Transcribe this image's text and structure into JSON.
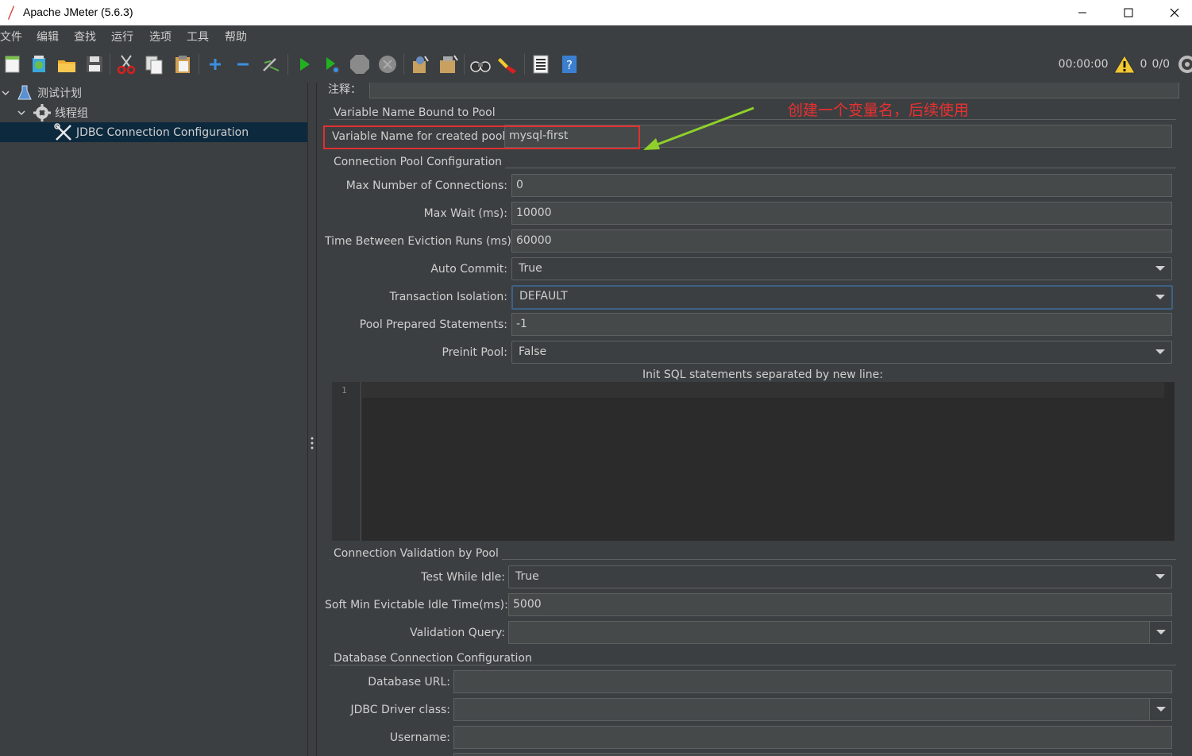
{
  "window": {
    "title": "Apache JMeter (5.6.3)"
  },
  "menu": [
    "文件",
    "编辑",
    "查找",
    "运行",
    "选项",
    "工具",
    "帮助"
  ],
  "toolbar": {
    "icons": [
      "new-icon",
      "templates-icon",
      "open-icon",
      "save-icon",
      "cut-icon",
      "copy-icon",
      "paste-icon",
      "expand-icon",
      "collapse-icon",
      "toggle-icon",
      "start-icon",
      "start-no-pause-icon",
      "stop-icon",
      "shutdown-icon",
      "clear-icon",
      "clear-all-icon",
      "search-icon",
      "reset-search-icon",
      "function-helper-icon",
      "help-icon"
    ],
    "timer": "00:00:00",
    "warning_count": "0",
    "threads": "0/0"
  },
  "tree": {
    "items": [
      {
        "label": "测试计划",
        "level": 0
      },
      {
        "label": "线程组",
        "level": 1
      },
      {
        "label": "JDBC Connection Configuration",
        "level": 2,
        "selected": true
      }
    ]
  },
  "form": {
    "comment_label": "注释：",
    "comment_value": "",
    "pool_section": "Variable Name Bound to Pool",
    "var_name_label": "Variable Name for created pool:",
    "var_name_value": "mysql-first",
    "annotation": "创建一个变量名，后续使用",
    "conn_pool_section": "Connection Pool Configuration",
    "max_conn_label": "Max Number of Connections:",
    "max_conn_value": "0",
    "max_wait_label": "Max Wait (ms):",
    "max_wait_value": "10000",
    "eviction_label": "Time Between Eviction Runs (ms):",
    "eviction_value": "60000",
    "auto_commit_label": "Auto Commit:",
    "auto_commit_value": "True",
    "isolation_label": "Transaction Isolation:",
    "isolation_value": "DEFAULT",
    "prepared_label": "Pool Prepared Statements:",
    "prepared_value": "-1",
    "preinit_label": "Preinit Pool:",
    "preinit_value": "False",
    "init_sql_label": "Init SQL statements separated by new line:",
    "init_sql_line": "1",
    "validation_section": "Connection Validation by Pool",
    "test_idle_label": "Test While Idle:",
    "test_idle_value": "True",
    "soft_min_label": "Soft Min Evictable Idle Time(ms):",
    "soft_min_value": "5000",
    "validation_query_label": "Validation Query:",
    "validation_query_value": "",
    "db_section": "Database Connection Configuration",
    "db_url_label": "Database URL:",
    "db_url_value": "",
    "driver_label": "JDBC Driver class:",
    "driver_value": "",
    "username_label": "Username:",
    "username_value": ""
  },
  "colors": {
    "background": "#3c3f41",
    "field": "#45494a",
    "selection": "#0d293e",
    "annotation": "#e83030",
    "arrow": "#8fd12a"
  }
}
